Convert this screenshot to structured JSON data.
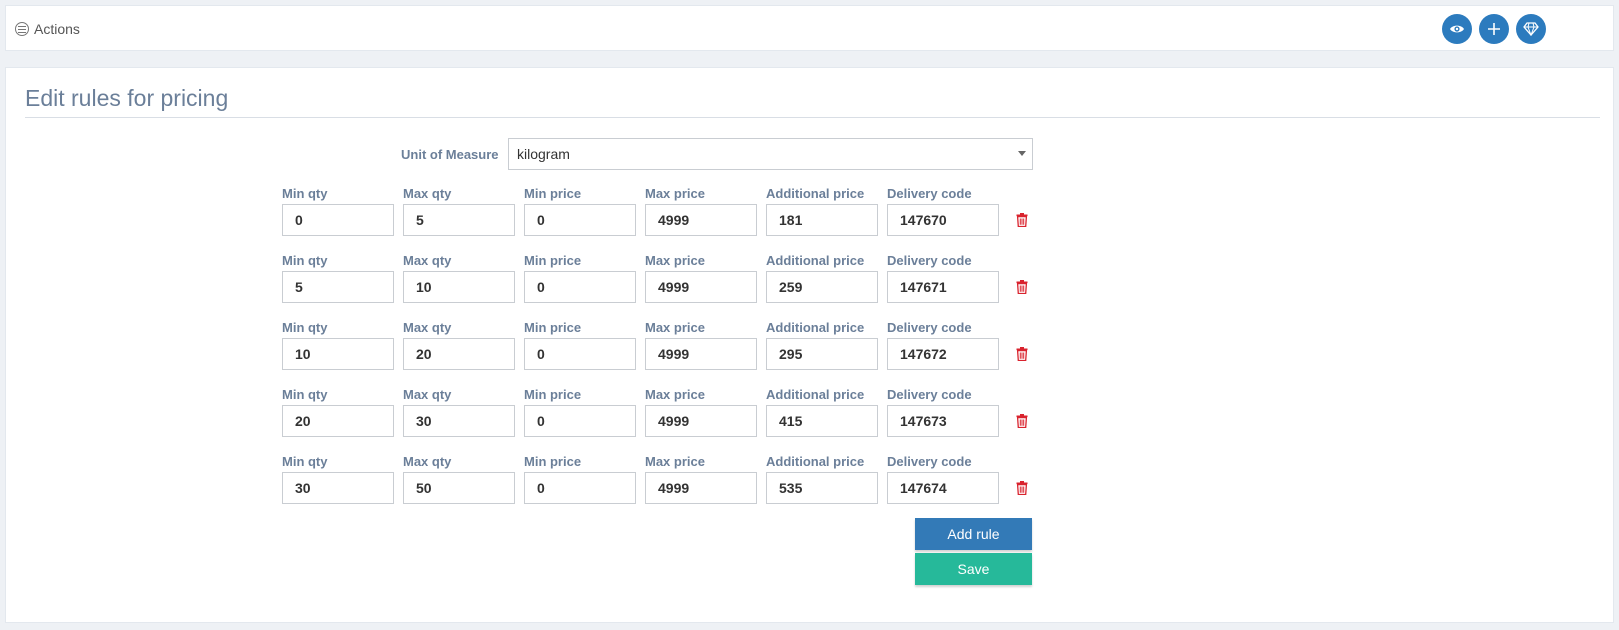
{
  "header": {
    "actions_label": "Actions",
    "buttons": [
      {
        "icon": "eye-icon",
        "name": "view"
      },
      {
        "icon": "plus-icon",
        "name": "add"
      },
      {
        "icon": "diamond-icon",
        "name": "premium"
      }
    ],
    "accent_color": "#2c7bbe"
  },
  "panel": {
    "title": "Edit rules for pricing",
    "unit_of_measure": {
      "label": "Unit of Measure",
      "selected": "kilogram"
    },
    "field_labels": {
      "min_qty": "Min qty",
      "max_qty": "Max qty",
      "min_price": "Min price",
      "max_price": "Max price",
      "additional_price": "Additional price",
      "delivery_code": "Delivery code"
    },
    "rules": [
      {
        "min_qty": "0",
        "max_qty": "5",
        "min_price": "0",
        "max_price": "4999",
        "additional_price": "181",
        "delivery_code": "147670"
      },
      {
        "min_qty": "5",
        "max_qty": "10",
        "min_price": "0",
        "max_price": "4999",
        "additional_price": "259",
        "delivery_code": "147671"
      },
      {
        "min_qty": "10",
        "max_qty": "20",
        "min_price": "0",
        "max_price": "4999",
        "additional_price": "295",
        "delivery_code": "147672"
      },
      {
        "min_qty": "20",
        "max_qty": "30",
        "min_price": "0",
        "max_price": "4999",
        "additional_price": "415",
        "delivery_code": "147673"
      },
      {
        "min_qty": "30",
        "max_qty": "50",
        "min_price": "0",
        "max_price": "4999",
        "additional_price": "535",
        "delivery_code": "147674"
      }
    ],
    "delete_icon": "trash-icon",
    "delete_color": "#d9232e",
    "add_rule_label": "Add rule",
    "save_label": "Save",
    "add_rule_color": "#337ab7",
    "save_color": "#26b99a"
  }
}
